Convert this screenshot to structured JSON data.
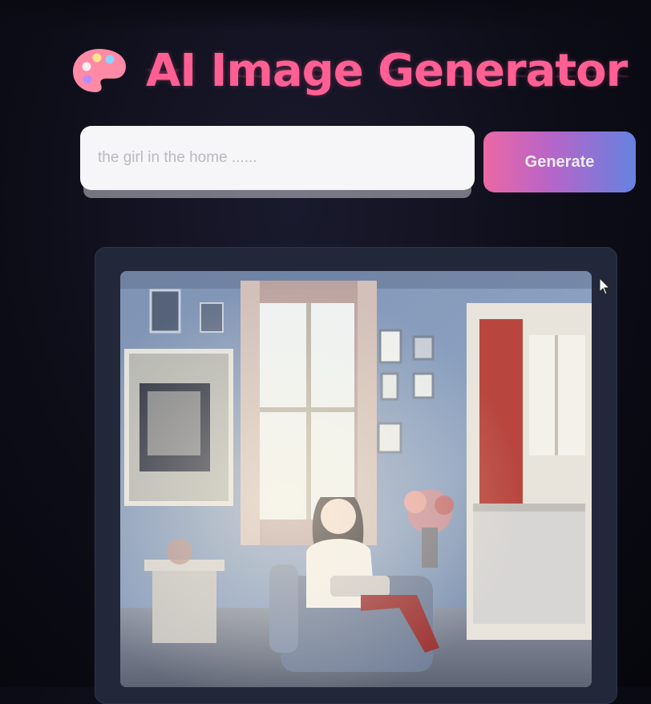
{
  "app": {
    "title": "AI Image Generator",
    "title_icon": "palette-icon",
    "accent_color": "#ff5f93"
  },
  "form": {
    "prompt_value": "the girl in the home ......",
    "generate_label": "Generate",
    "button_gradient": [
      "#ff6fb1",
      "#c46dd8",
      "#6d8cf2"
    ]
  },
  "result": {
    "icon": "generated-image"
  }
}
